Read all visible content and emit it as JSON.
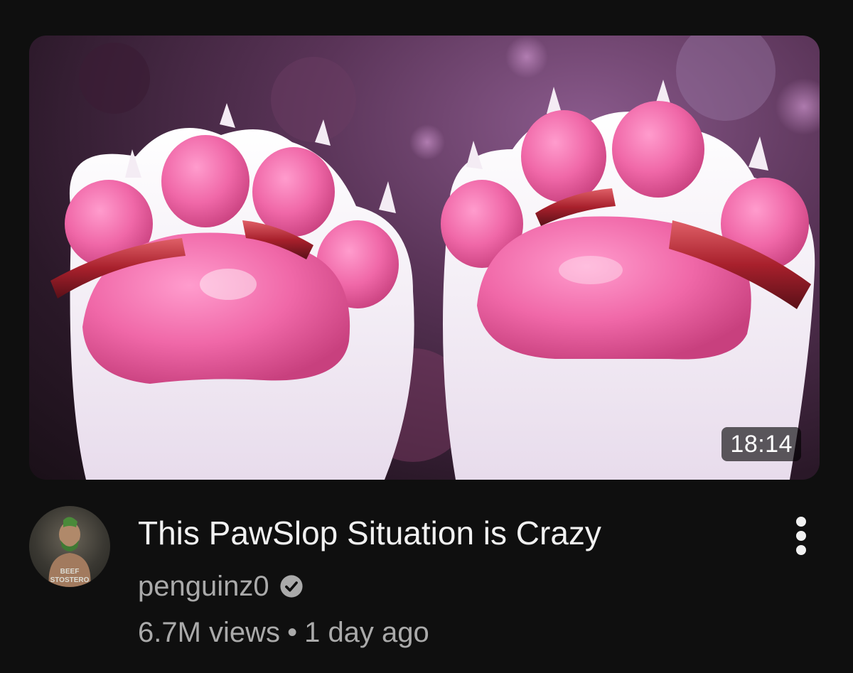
{
  "video": {
    "duration": "18:14",
    "title": "This PawSlop Situation is Crazy",
    "channel": "penguinz0",
    "views": "6.7M views",
    "separator": "•",
    "age": "1 day ago"
  },
  "avatar": {
    "text": "BEEF\nSTOSTERO"
  },
  "icons": {
    "verified": "verified-check-icon",
    "more": "more-vert-icon"
  },
  "colors": {
    "background": "#0f0f0f",
    "title": "#f1f1f1",
    "secondary_text": "#aaaaaa",
    "paw_pad": "#f06aa8",
    "ring": "#c0303a"
  }
}
